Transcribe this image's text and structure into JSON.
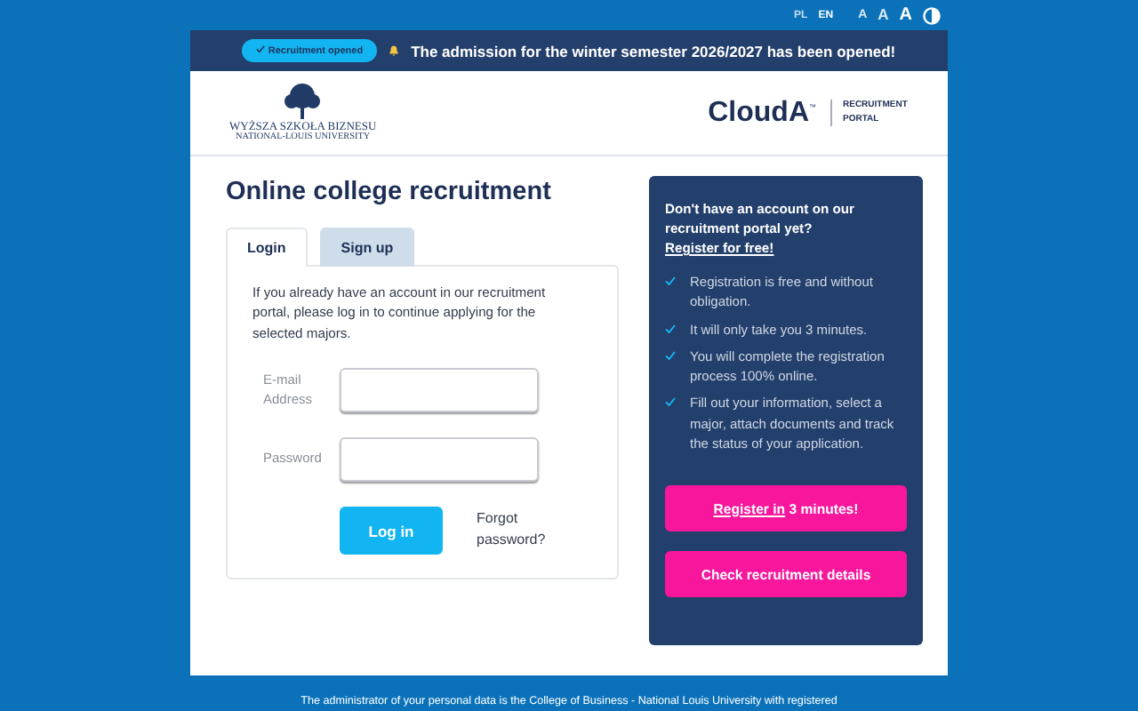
{
  "top_bar": {
    "languages": [
      {
        "label": "PL",
        "selected": false
      },
      {
        "label": "EN",
        "selected": true
      }
    ],
    "font_sizes": [
      {
        "label": "A",
        "selected": false
      },
      {
        "label": "A",
        "selected": false
      },
      {
        "label": "A",
        "selected": true
      }
    ]
  },
  "banner": {
    "badge": "Recruitment opened",
    "message": "The admission for the winter semester 2026/2027 has been opened!"
  },
  "header": {
    "university_name": "WYŻSZA SZKOŁA BIZNESU",
    "university_subname": "NATIONAL-LOUIS UNIVERSITY",
    "product": "CloudA",
    "product_mark": "™",
    "portal_label": "RECRUITMENT PORTAL"
  },
  "title": "Online college recruitment",
  "tabs": [
    {
      "label": "Login",
      "selected": true
    },
    {
      "label": "Sign up",
      "selected": false
    }
  ],
  "login": {
    "intro": "If you already have an account in our recruitment portal, please log in to continue applying for the selected majors.",
    "fields": [
      {
        "label": "E-mail Address"
      },
      {
        "label": "Password"
      }
    ],
    "submit": "Log in",
    "forgot": "Forgot password?"
  },
  "register_panel": {
    "heading": "Don't have an account on our recruitment portal yet?",
    "link": "Register for free!",
    "benefits": [
      "Registration is free and without obligation.",
      "It will only take you 3 minutes.",
      "You will complete the registration process 100% online.",
      "Fill out your information, select a major, attach documents and track the status of your application."
    ],
    "register_button": {
      "link": "Register in",
      "rest": "3 minutes!"
    },
    "details_button": "Check recruitment details"
  },
  "footer": "The administrator of your personal data is the College of Business - National Louis University with registered"
}
